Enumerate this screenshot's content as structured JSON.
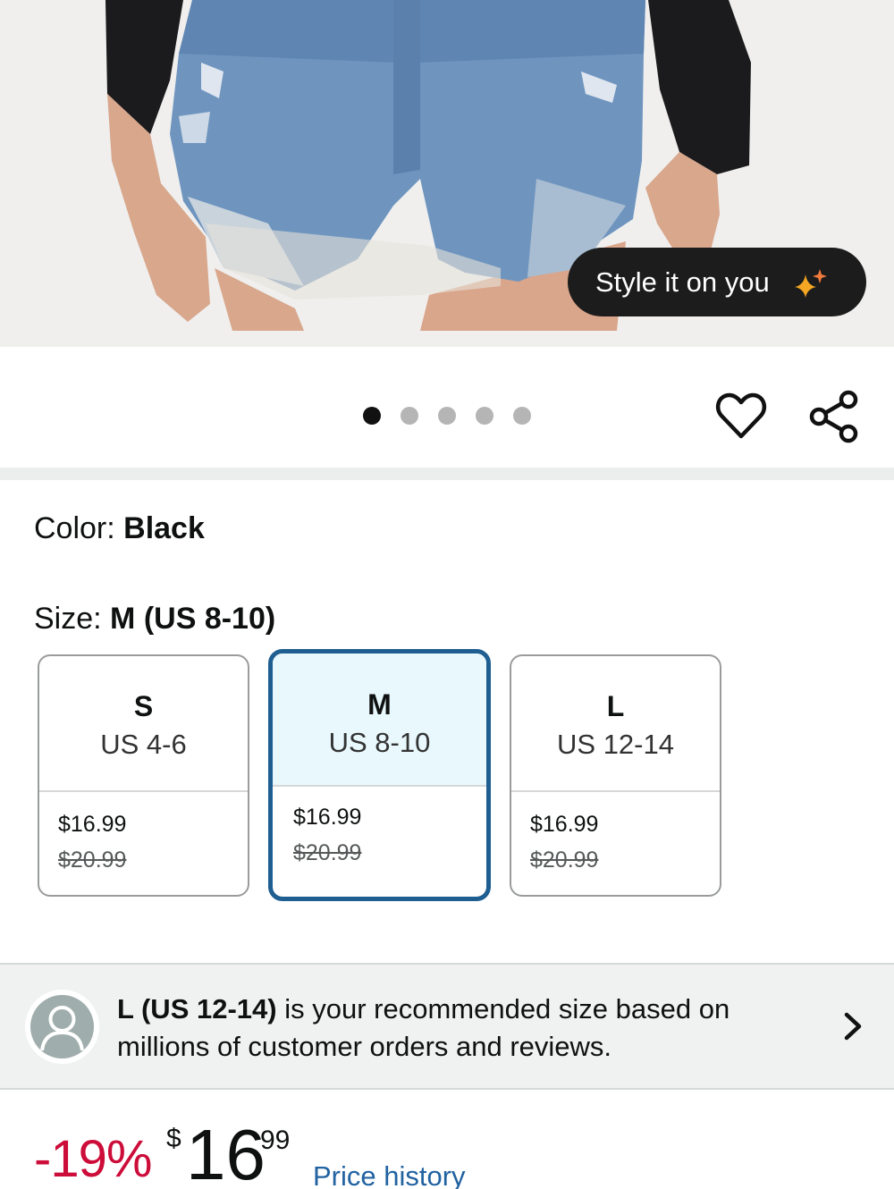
{
  "hero": {
    "style_button_label": "Style it on you",
    "style_button_icon": "sparkle-icon"
  },
  "carousel": {
    "total_images": 5,
    "active_index": 0
  },
  "actions": {
    "favorite_icon": "heart-icon",
    "share_icon": "share-icon"
  },
  "color": {
    "label": "Color: ",
    "value": "Black"
  },
  "size": {
    "label": "Size: ",
    "value": "M (US 8-10)",
    "options": [
      {
        "letter": "S",
        "range": "US 4-6",
        "price": "$16.99",
        "was": "$20.99",
        "selected": false
      },
      {
        "letter": "M",
        "range": "US 8-10",
        "price": "$16.99",
        "was": "$20.99",
        "selected": true
      },
      {
        "letter": "L",
        "range": "US 12-14",
        "price": "$16.99",
        "was": "$20.99",
        "selected": false
      }
    ]
  },
  "recommendation": {
    "size": "L (US 12-14)",
    "text": " is your recommended size based on millions of customer orders and reviews."
  },
  "price": {
    "discount": "-19%",
    "currency": "$",
    "dollars": "16",
    "cents": "99",
    "history_link": "Price history"
  },
  "colors": {
    "accent_blue": "#1f5e91",
    "selected_bg": "#e8f8fd",
    "discount_red": "#cc0c39",
    "link_blue": "#2162a1"
  }
}
